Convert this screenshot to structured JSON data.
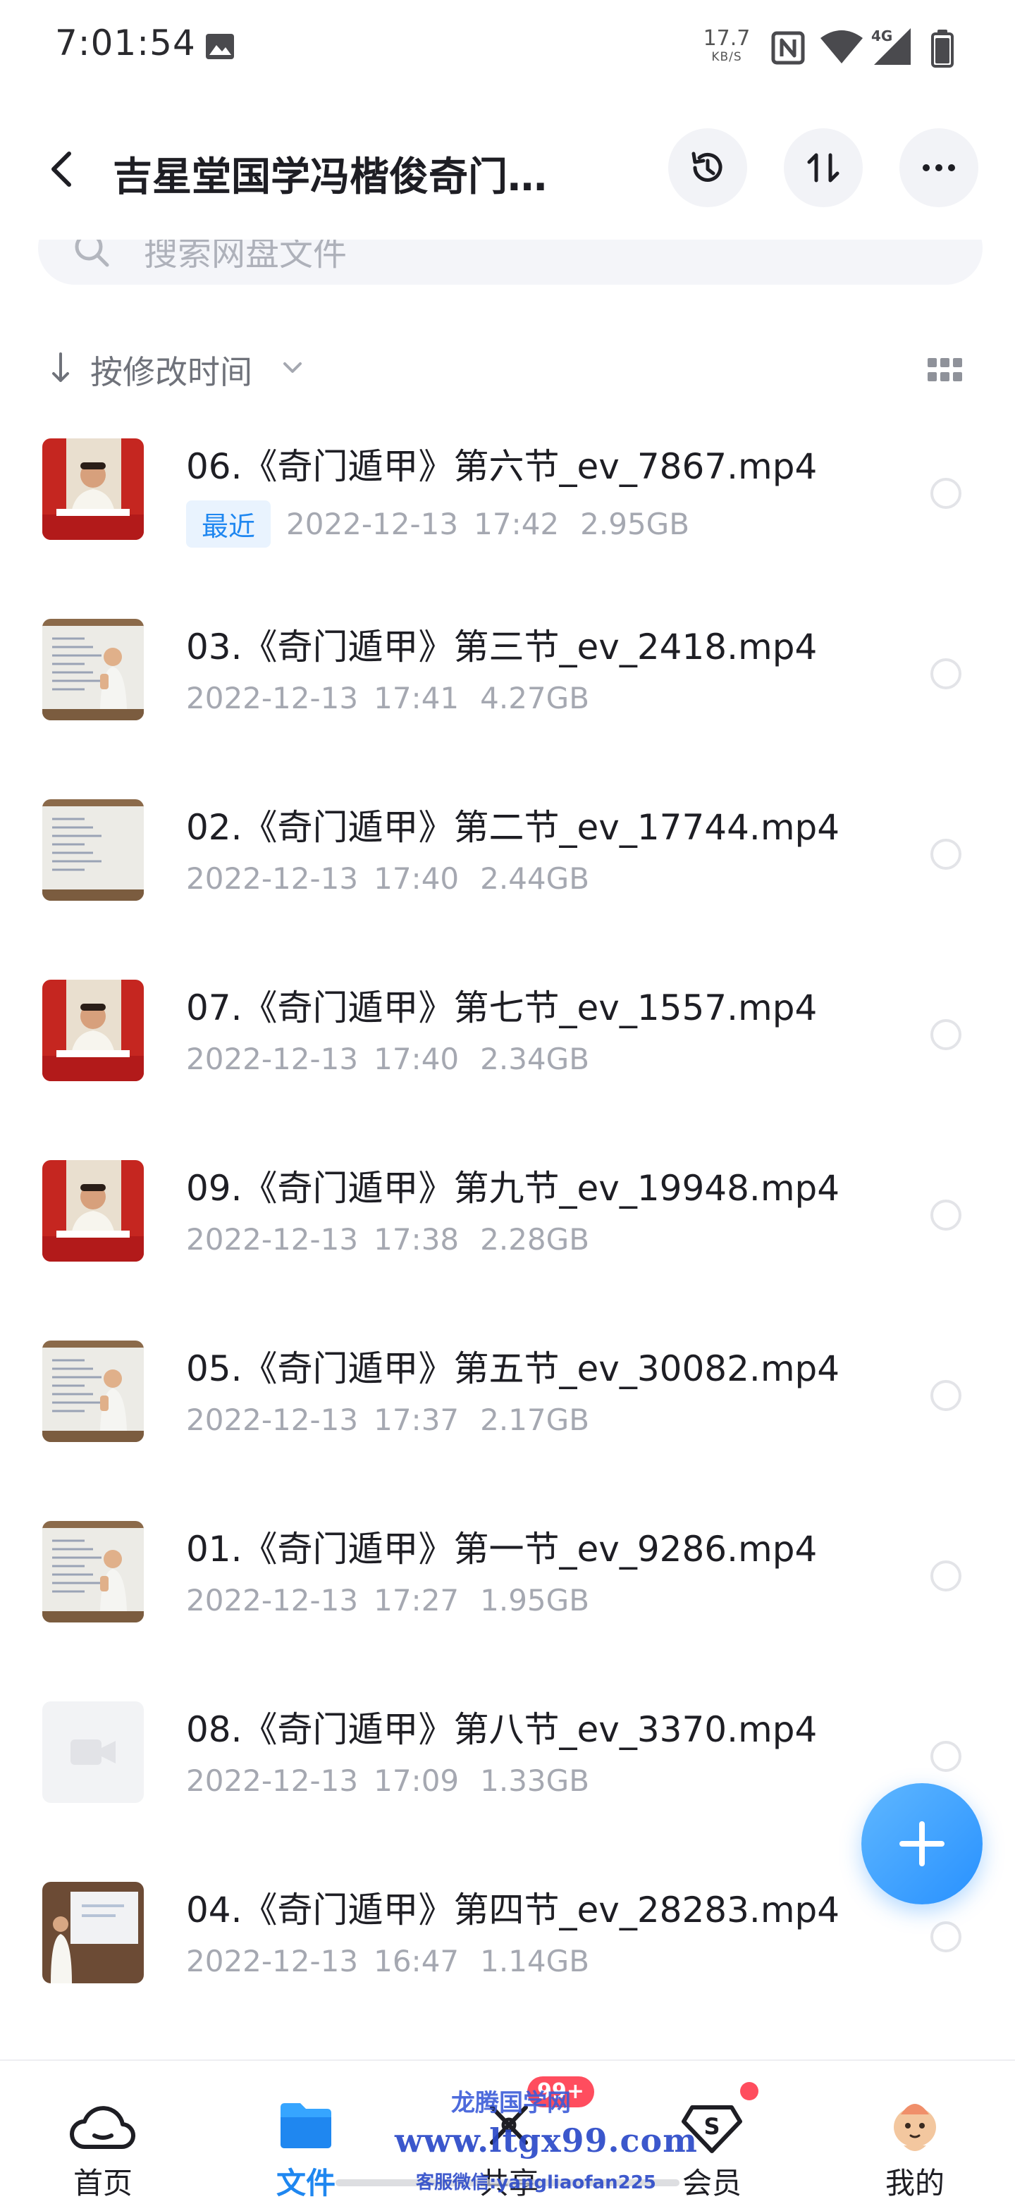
{
  "status_bar": {
    "time": "7:01:54",
    "net_speed_value": "17.7",
    "net_speed_unit": "KB/S",
    "network_type": "4G"
  },
  "header": {
    "title": "吉星堂国学冯楷俊奇门…",
    "icons": [
      "chevron-left-icon",
      "history-icon",
      "sort-icon",
      "more-icon"
    ]
  },
  "search": {
    "placeholder": "搜索网盘文件"
  },
  "sort": {
    "label": "按修改时间"
  },
  "files": [
    {
      "name": "06.《奇门遁甲》第六节_ev_7867.mp4",
      "badge": "最近",
      "date": "2022-12-13",
      "time": "17:42",
      "size": "2.95GB",
      "thumb": "teacher-desk"
    },
    {
      "name": "03.《奇门遁甲》第三节_ev_2418.mp4",
      "badge": "",
      "date": "2022-12-13",
      "time": "17:41",
      "size": "4.27GB",
      "thumb": "whiteboard-standing"
    },
    {
      "name": "02.《奇门遁甲》第二节_ev_17744.mp4",
      "badge": "",
      "date": "2022-12-13",
      "time": "17:40",
      "size": "2.44GB",
      "thumb": "whiteboard"
    },
    {
      "name": "07.《奇门遁甲》第七节_ev_1557.mp4",
      "badge": "",
      "date": "2022-12-13",
      "time": "17:40",
      "size": "2.34GB",
      "thumb": "teacher-desk"
    },
    {
      "name": "09.《奇门遁甲》第九节_ev_19948.mp4",
      "badge": "",
      "date": "2022-12-13",
      "time": "17:38",
      "size": "2.28GB",
      "thumb": "teacher-desk"
    },
    {
      "name": "05.《奇门遁甲》第五节_ev_30082.mp4",
      "badge": "",
      "date": "2022-12-13",
      "time": "17:37",
      "size": "2.17GB",
      "thumb": "whiteboard-standing"
    },
    {
      "name": "01.《奇门遁甲》第一节_ev_9286.mp4",
      "badge": "",
      "date": "2022-12-13",
      "time": "17:27",
      "size": "1.95GB",
      "thumb": "whiteboard-standing"
    },
    {
      "name": "08.《奇门遁甲》第八节_ev_3370.mp4",
      "badge": "",
      "date": "2022-12-13",
      "time": "17:09",
      "size": "1.33GB",
      "thumb": "video-placeholder"
    },
    {
      "name": "04.《奇门遁甲》第四节_ev_28283.mp4",
      "badge": "",
      "date": "2022-12-13",
      "time": "16:47",
      "size": "1.14GB",
      "thumb": "projector"
    }
  ],
  "fab": {
    "icon": "plus-icon"
  },
  "bottom_nav": [
    {
      "label": "首页",
      "icon": "cloud-home-icon",
      "active": false
    },
    {
      "label": "文件",
      "icon": "folder-icon",
      "active": true
    },
    {
      "label": "共享",
      "icon": "share-icon",
      "active": false,
      "badge": "99+"
    },
    {
      "label": "会员",
      "icon": "vip-diamond-icon",
      "active": false,
      "dot": true
    },
    {
      "label": "我的",
      "icon": "avatar-icon",
      "active": false
    }
  ],
  "watermark": {
    "logo": "龙腾国学网",
    "url": "www.ltgx99.com",
    "contact": "客服微信:yangliaofan225"
  },
  "colors": {
    "accent": "#1f87f0",
    "text_primary": "#1e1e24",
    "text_secondary": "#a5a8b1",
    "badge_red": "#ff4d5e",
    "button_bg": "#f2f3f7"
  }
}
